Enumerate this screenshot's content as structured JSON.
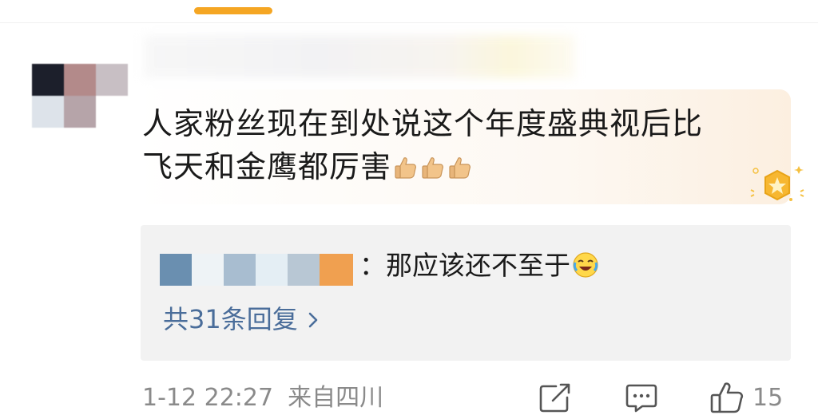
{
  "comment": {
    "text_line1": "人家粉丝现在到处说这个年度盛典视后比",
    "text_line2": "飞天和金鹰都厉害",
    "thumb_emojis": [
      "thumbs-up-icon",
      "thumbs-up-icon",
      "thumbs-up-icon"
    ],
    "badge": "star-badge-icon"
  },
  "reply": {
    "text": "：那应该还不至于",
    "emoji": "laughing-crying-icon",
    "count_label": "共31条回复"
  },
  "footer": {
    "date": "1-12 22:27",
    "location": "来自四川",
    "like_count": "15"
  },
  "colors": {
    "accent": "#f5a623",
    "link": "#4a6d9a",
    "muted": "#8a8a8a"
  }
}
